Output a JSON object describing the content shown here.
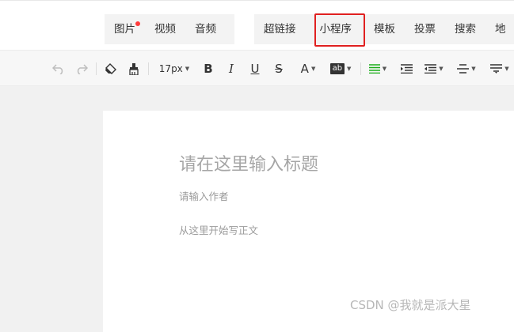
{
  "top_menu": {
    "media_items": [
      {
        "label": "图片"
      },
      {
        "label": "视频"
      },
      {
        "label": "音频"
      }
    ],
    "tool_items": [
      {
        "label": "超链接"
      },
      {
        "label": "小程序"
      },
      {
        "label": "模板"
      },
      {
        "label": "投票"
      },
      {
        "label": "搜索"
      },
      {
        "label": "地"
      }
    ],
    "highlighted_item": "小程序",
    "badge_color": "#ff3b3b",
    "highlight_color": "#e02020"
  },
  "toolbar": {
    "font_size": "17px",
    "bold": "B",
    "italic": "I",
    "underline": "U",
    "strikethrough": "S",
    "font_color": "A",
    "background_color": "ab",
    "accent_color": "#1aad19"
  },
  "editor": {
    "title_placeholder": "请在这里输入标题",
    "author_placeholder": "请输入作者",
    "body_placeholder": "从这里开始写正文"
  },
  "watermark": "CSDN @我就是派大星"
}
